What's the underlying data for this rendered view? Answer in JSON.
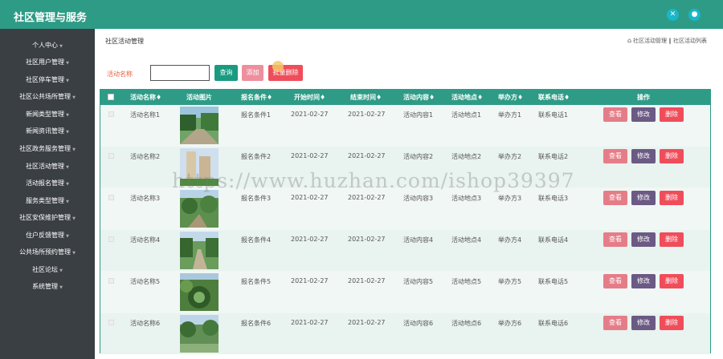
{
  "app": {
    "title": "社区管理与服务"
  },
  "topbar": {
    "icons": [
      "fullscreen-icon",
      "user-icon"
    ]
  },
  "sidebar": {
    "items": [
      {
        "label": "个人中心"
      },
      {
        "label": "社区用户管理"
      },
      {
        "label": "社区停车管理"
      },
      {
        "label": "社区公共场所管理"
      },
      {
        "label": "新闻类型管理"
      },
      {
        "label": "新闻资讯管理"
      },
      {
        "label": "社区政务服务管理"
      },
      {
        "label": "社区活动管理"
      },
      {
        "label": "活动报名管理"
      },
      {
        "label": "服务类型管理"
      },
      {
        "label": "社区安保维护管理"
      },
      {
        "label": "住户反馈管理"
      },
      {
        "label": "公共场所预约管理"
      },
      {
        "label": "社区论坛"
      },
      {
        "label": "系统管理"
      }
    ]
  },
  "page": {
    "title": "社区活动管理",
    "breadcrumb": "社区活动管理 ‖ 社区活动列表"
  },
  "search": {
    "label": "活动名称",
    "value": "",
    "placeholder": "",
    "query_label": "查询",
    "add_label": "添加",
    "batch_delete_label": "批量删除"
  },
  "table": {
    "columns": [
      "活动名称",
      "活动图片",
      "报名条件",
      "开始时间",
      "结束时间",
      "活动内容",
      "活动地点",
      "举办方",
      "联系电话",
      "操作"
    ],
    "sort_mark": "♦",
    "rows": [
      {
        "name": "活动名称1",
        "condition": "报名条件1",
        "start": "2021-02-27",
        "end": "2021-02-27",
        "content": "活动内容1",
        "place": "活动地点1",
        "host": "举办方1",
        "phone": "联系电话1"
      },
      {
        "name": "活动名称2",
        "condition": "报名条件2",
        "start": "2021-02-27",
        "end": "2021-02-27",
        "content": "活动内容2",
        "place": "活动地点2",
        "host": "举办方2",
        "phone": "联系电话2"
      },
      {
        "name": "活动名称3",
        "condition": "报名条件3",
        "start": "2021-02-27",
        "end": "2021-02-27",
        "content": "活动内容3",
        "place": "活动地点3",
        "host": "举办方3",
        "phone": "联系电话3"
      },
      {
        "name": "活动名称4",
        "condition": "报名条件4",
        "start": "2021-02-27",
        "end": "2021-02-27",
        "content": "活动内容4",
        "place": "活动地点4",
        "host": "举办方4",
        "phone": "联系电话4"
      },
      {
        "name": "活动名称5",
        "condition": "报名条件5",
        "start": "2021-02-27",
        "end": "2021-02-27",
        "content": "活动内容5",
        "place": "活动地点5",
        "host": "举办方5",
        "phone": "联系电话5"
      },
      {
        "name": "活动名称6",
        "condition": "报名条件6",
        "start": "2021-02-27",
        "end": "2021-02-27",
        "content": "活动内容6",
        "place": "活动地点6",
        "host": "举办方6",
        "phone": "联系电话6"
      }
    ],
    "actions": {
      "view": "查看",
      "edit": "修改",
      "delete": "删除"
    }
  },
  "watermark": "https://www.huzhan.com/ishop39397",
  "colors": {
    "primary": "#2e9b86",
    "sidebar": "#3a3f44",
    "danger": "#f04d5b",
    "view": "#e57d88",
    "edit": "#6b5a84"
  }
}
